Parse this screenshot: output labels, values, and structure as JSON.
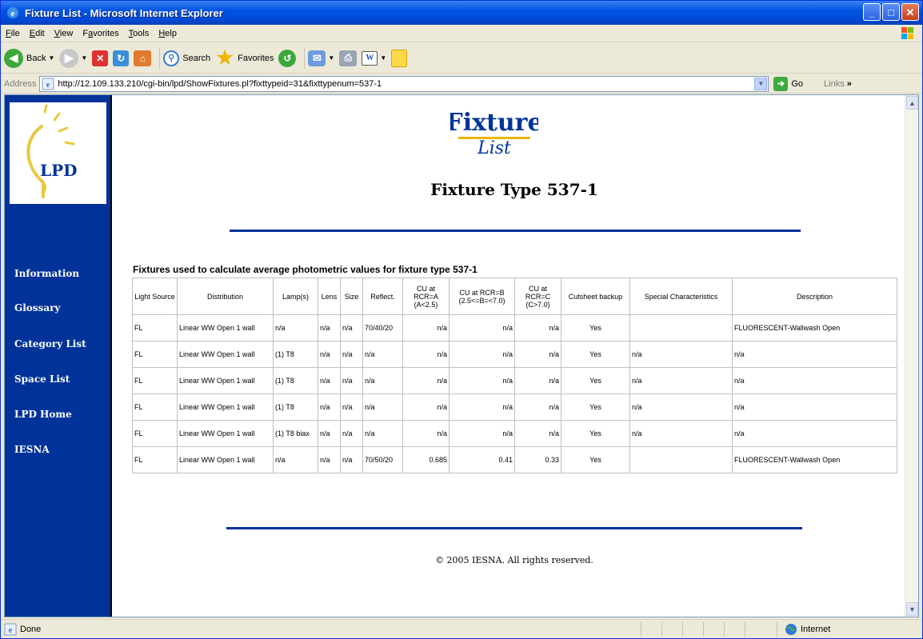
{
  "window": {
    "title": "Fixture List - Microsoft Internet Explorer",
    "controls": {
      "minimize": "_",
      "maximize": "□",
      "close": "✕"
    }
  },
  "menu": {
    "items": [
      {
        "pre": "",
        "key": "F",
        "post": "ile"
      },
      {
        "pre": "",
        "key": "E",
        "post": "dit"
      },
      {
        "pre": "",
        "key": "V",
        "post": "iew"
      },
      {
        "pre": "F",
        "key": "a",
        "post": "vorites"
      },
      {
        "pre": "",
        "key": "T",
        "post": "ools"
      },
      {
        "pre": "",
        "key": "H",
        "post": "elp"
      }
    ]
  },
  "toolbar": {
    "back": "Back",
    "search": "Search",
    "favorites": "Favorites"
  },
  "address": {
    "label": "Address",
    "url": "http://12.109.133.210/cgi-bin/lpd/ShowFixtures.pl?fixttypeid=31&fixttypenum=537-1",
    "go": "Go",
    "links": "Links",
    "links_arrow": "»"
  },
  "sidebar": {
    "logo_text": "LPD",
    "nav": [
      "Information",
      "Glossary",
      "Category List",
      "Space List",
      "LPD Home",
      "IESNA"
    ]
  },
  "page": {
    "banner_top": "Fixture",
    "banner_bottom": "List",
    "title": "Fixture Type 537-1",
    "caption": "Fixtures used to calculate average photometric values for fixture type 537-1",
    "copyright": "© 2005 IESNA. All rights reserved."
  },
  "table": {
    "headers": [
      "Light Source",
      "Distribution",
      "Lamp(s)",
      "Lens",
      "Size",
      "Reflect.",
      "CU at RCR=A (A<2.5)",
      "CU at RCR=B (2.5<=B=<7.0)",
      "CU at RCR=C (C>7.0)",
      "Cutsheet backup",
      "Special Characteristics",
      "Description"
    ],
    "rows": [
      [
        "FL",
        "Linear WW Open 1 wall",
        "n/a",
        "n/a",
        "n/a",
        "70/40/20",
        "n/a",
        "n/a",
        "n/a",
        "Yes",
        "",
        "FLUORESCENT-Wallwash Open"
      ],
      [
        "FL",
        "Linear WW Open 1 wall",
        "(1) T8",
        "n/a",
        "n/a",
        "n/a",
        "n/a",
        "n/a",
        "n/a",
        "Yes",
        "n/a",
        "n/a"
      ],
      [
        "FL",
        "Linear WW Open 1 wall",
        "(1) T8",
        "n/a",
        "n/a",
        "n/a",
        "n/a",
        "n/a",
        "n/a",
        "Yes",
        "n/a",
        "n/a"
      ],
      [
        "FL",
        "Linear WW Open 1 wall",
        "(1) T8",
        "n/a",
        "n/a",
        "n/a",
        "n/a",
        "n/a",
        "n/a",
        "Yes",
        "n/a",
        "n/a"
      ],
      [
        "FL",
        "Linear WW Open 1 wall",
        "(1) T8 biax",
        "n/a",
        "n/a",
        "n/a",
        "n/a",
        "n/a",
        "n/a",
        "Yes",
        "n/a",
        "n/a"
      ],
      [
        "FL",
        "Linear WW Open 1 wall",
        "n/a",
        "n/a",
        "n/a",
        "70/50/20",
        "0.685",
        "0.41",
        "0.33",
        "Yes",
        "",
        "FLUORESCENT-Wallwash Open"
      ]
    ]
  },
  "status": {
    "text": "Done",
    "zone": "Internet"
  },
  "colors": {
    "sidebar": "#003399",
    "rule": "#003399",
    "banner": "#003399",
    "banner_underline": "#e8b800",
    "titlebar": "#0054e3"
  }
}
